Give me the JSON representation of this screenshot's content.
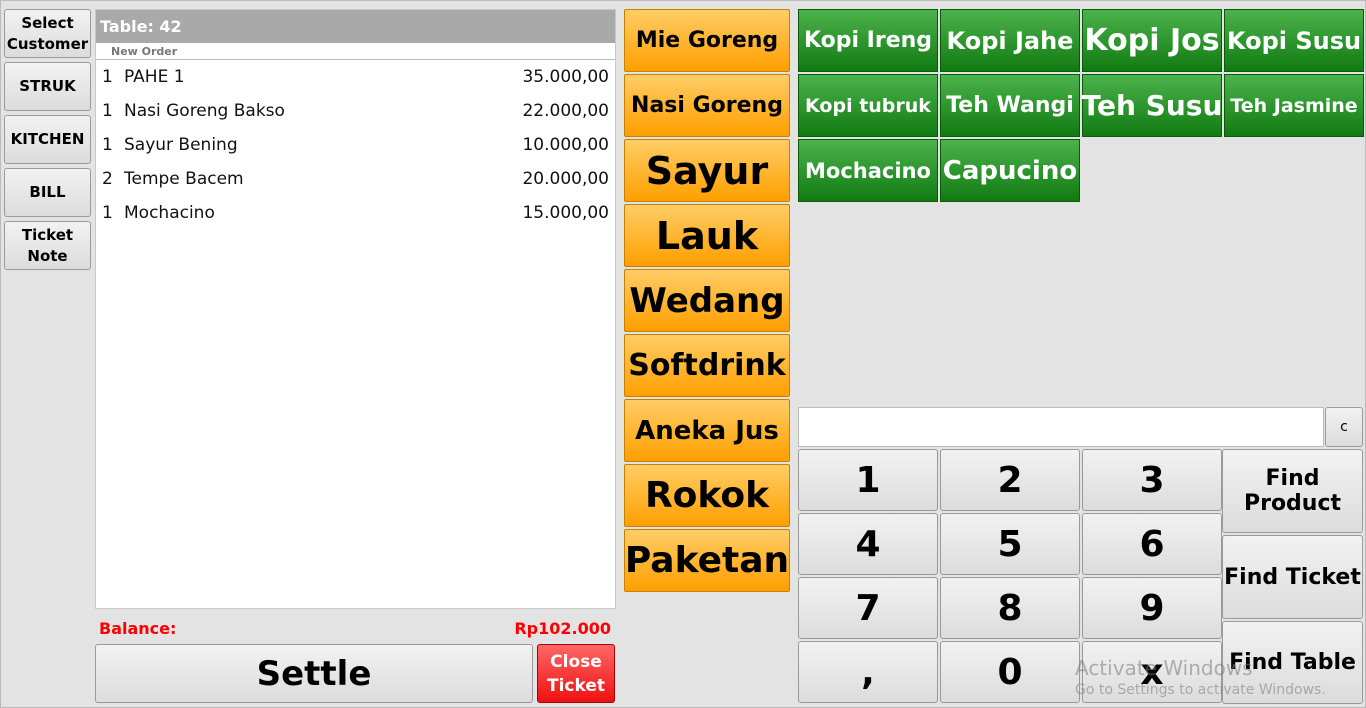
{
  "left_buttons": [
    "Select Customer",
    "STRUK",
    "KITCHEN",
    "BILL",
    "Ticket Note"
  ],
  "ticket": {
    "title": "Table: 42",
    "subtitle": "New Order",
    "items": [
      {
        "qty": "1",
        "name": "PAHE 1",
        "price": "35.000,00"
      },
      {
        "qty": "1",
        "name": "Nasi Goreng Bakso",
        "price": "22.000,00"
      },
      {
        "qty": "1",
        "name": "Sayur Bening",
        "price": "10.000,00"
      },
      {
        "qty": "2",
        "name": "Tempe Bacem",
        "price": "20.000,00"
      },
      {
        "qty": "1",
        "name": "Mochacino",
        "price": "15.000,00"
      }
    ],
    "balance_label": "Balance:",
    "balance_value": "Rp102.000",
    "settle": "Settle",
    "close": "Close Ticket"
  },
  "categories": [
    "Mie Goreng",
    "Nasi Goreng",
    "Sayur",
    "Lauk",
    "Wedang",
    "Softdrink",
    "Aneka Jus",
    "Rokok",
    "Paketan"
  ],
  "products": [
    "Kopi Ireng",
    "Kopi Jahe",
    "Kopi Jos",
    "Kopi Susu",
    "Kopi tubruk",
    "Teh Wangi",
    "Teh Susu",
    "Teh Jasmine",
    "Mochacino",
    "Capucino"
  ],
  "search": {
    "value": "",
    "clear": "c"
  },
  "keypad": [
    "1",
    "2",
    "3",
    "4",
    "5",
    "6",
    "7",
    "8",
    "9",
    ",",
    "0",
    "x"
  ],
  "find_buttons": [
    "Find Product",
    "Find Ticket",
    "Find Table"
  ],
  "watermark": {
    "title": "Activate Windows",
    "subtitle": "Go to Settings to activate Windows."
  },
  "colors": {
    "category": "#ffa500",
    "product": "#1e8c1e",
    "close": "#ff3333",
    "balance": "#ff0000"
  }
}
